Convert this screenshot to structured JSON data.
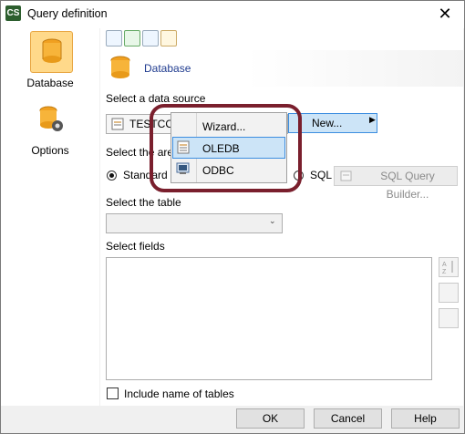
{
  "window": {
    "title": "Query definition",
    "app_icon_text": "CS"
  },
  "nav": {
    "database_label": "Database",
    "options_label": "Options"
  },
  "header": {
    "title": "Database"
  },
  "datasource": {
    "label": "Select a data source",
    "value": "TESTCON",
    "new_label": "New..."
  },
  "area": {
    "label": "Select the area",
    "standard_label": "Standard",
    "sql_label": "SQL",
    "sql_builder_label": "SQL Query Builder..."
  },
  "table": {
    "label": "Select the table",
    "value": ""
  },
  "fields": {
    "label": "Select fields",
    "include_label": "Include name of tables"
  },
  "context_menu": {
    "items": [
      {
        "label": "Wizard...",
        "icon": "none"
      },
      {
        "label": "OLEDB",
        "icon": "oledb-icon",
        "highlighted": true
      },
      {
        "label": "ODBC",
        "icon": "odbc-icon"
      }
    ]
  },
  "buttons": {
    "ok": "OK",
    "cancel": "Cancel",
    "help": "Help"
  },
  "colors": {
    "accent": "#1f3b8f",
    "highlight": "#cce4f7",
    "ring": "#7a1f2d",
    "nav_selected": "#ffd98a"
  }
}
